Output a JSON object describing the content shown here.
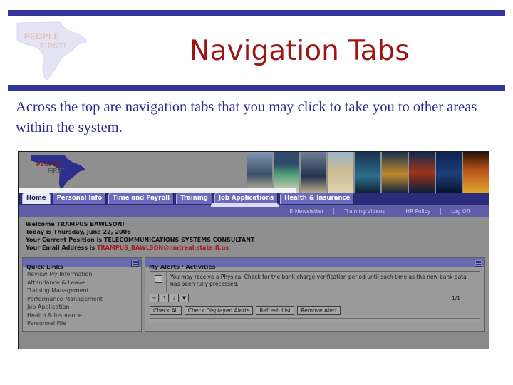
{
  "slide": {
    "title": "Navigation Tabs",
    "body_text": "Across the top are navigation tabs that you may click to take you to other areas within the system.",
    "logo": {
      "line1": "PEOPLE",
      "line2": "FIRST!"
    },
    "colors": {
      "rule_blue": "#33339a",
      "title_red": "#9e1515",
      "body_blue": "#2b2b8f"
    }
  },
  "screenshot": {
    "logo": {
      "line1": "PEOPLE",
      "line2": "FIRST!"
    },
    "tabs": [
      {
        "label": "Home",
        "active": true
      },
      {
        "label": "Personal Info",
        "active": false
      },
      {
        "label": "Time and Payroll",
        "active": false
      },
      {
        "label": "Training",
        "active": false
      },
      {
        "label": "Job Applications",
        "active": false
      },
      {
        "label": "Health & Insurance",
        "active": false
      }
    ],
    "subnav": [
      {
        "label": "E-Newsletter"
      },
      {
        "label": "Training Videos"
      },
      {
        "label": "HR Policy"
      },
      {
        "label": "Log Off"
      }
    ],
    "welcome": {
      "greeting": "Welcome TRAMPUS BAWLSON!",
      "today": "Today is Thursday, June 22, 2006",
      "position": "Your Current Position is TELECOMMUNICATIONS SYSTEMS CONSULTANT",
      "email_label": "Your Email Address is ",
      "email_value": "TRAMPUS_BAWLSON@nmtreal.state.fl.us"
    },
    "quick_links": {
      "title": "Quick Links",
      "items": [
        "Review My Information",
        "Attendance & Leave",
        "Training Management",
        "Performance Management",
        "Job Application",
        "Health & Insurance",
        "Personnel File"
      ]
    },
    "alerts": {
      "title": "My Alerts / Activities",
      "message": "You may receive a Physical Check for the bank charge verification period until such time as the new bank data has been fully processed.",
      "nav_buttons": [
        "≡",
        "⤒",
        "⤓",
        "▼"
      ],
      "page_count": "1/1",
      "buttons": [
        "Check All",
        "Check Displayed Alerts",
        "Refresh List",
        "Remove Alert"
      ]
    },
    "photostrip_colors": [
      "#4a5f7a",
      "#3e7a5e",
      "#2c3a52",
      "#c6b89a",
      "#2f5a78",
      "#b98a3a",
      "#1d3f6e",
      "#102a52",
      "#7a2f10"
    ]
  }
}
